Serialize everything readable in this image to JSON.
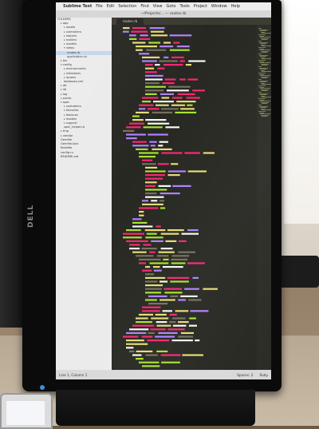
{
  "scene": {
    "monitor_brand": "DELL"
  },
  "menubar": {
    "app_name": "Sublime Text",
    "items": [
      "File",
      "Edit",
      "Selection",
      "Find",
      "View",
      "Goto",
      "Tools",
      "Project",
      "Window",
      "Help"
    ]
  },
  "window": {
    "title": "~/Projects/... — routes.rb"
  },
  "sidebar": {
    "items": [
      {
        "label": "FOLDERS",
        "indent": 0,
        "arrow": "",
        "selected": false
      },
      {
        "label": "app",
        "indent": 1,
        "arrow": "▸",
        "selected": false
      },
      {
        "label": "assets",
        "indent": 2,
        "arrow": "▸",
        "selected": false
      },
      {
        "label": "controllers",
        "indent": 2,
        "arrow": "▸",
        "selected": false
      },
      {
        "label": "helpers",
        "indent": 2,
        "arrow": "▸",
        "selected": false
      },
      {
        "label": "mailers",
        "indent": 2,
        "arrow": "▸",
        "selected": false
      },
      {
        "label": "models",
        "indent": 2,
        "arrow": "▸",
        "selected": false
      },
      {
        "label": "views",
        "indent": 2,
        "arrow": "▾",
        "selected": false
      },
      {
        "label": "routes.rb",
        "indent": 3,
        "arrow": "",
        "selected": true
      },
      {
        "label": "application.rb",
        "indent": 3,
        "arrow": "",
        "selected": false
      },
      {
        "label": "bin",
        "indent": 1,
        "arrow": "▸",
        "selected": false
      },
      {
        "label": "config",
        "indent": 1,
        "arrow": "▾",
        "selected": false
      },
      {
        "label": "environments",
        "indent": 2,
        "arrow": "▸",
        "selected": false
      },
      {
        "label": "initializers",
        "indent": 2,
        "arrow": "▸",
        "selected": false
      },
      {
        "label": "locales",
        "indent": 2,
        "arrow": "▸",
        "selected": false
      },
      {
        "label": "database.yml",
        "indent": 2,
        "arrow": "",
        "selected": false
      },
      {
        "label": "db",
        "indent": 1,
        "arrow": "▸",
        "selected": false
      },
      {
        "label": "lib",
        "indent": 1,
        "arrow": "▸",
        "selected": false
      },
      {
        "label": "log",
        "indent": 1,
        "arrow": "▸",
        "selected": false
      },
      {
        "label": "public",
        "indent": 1,
        "arrow": "▸",
        "selected": false
      },
      {
        "label": "spec",
        "indent": 1,
        "arrow": "▾",
        "selected": false
      },
      {
        "label": "controllers",
        "indent": 2,
        "arrow": "▸",
        "selected": false
      },
      {
        "label": "factories",
        "indent": 2,
        "arrow": "▸",
        "selected": false
      },
      {
        "label": "features",
        "indent": 2,
        "arrow": "▸",
        "selected": false
      },
      {
        "label": "models",
        "indent": 2,
        "arrow": "▸",
        "selected": false
      },
      {
        "label": "support",
        "indent": 2,
        "arrow": "▸",
        "selected": false
      },
      {
        "label": "spec_helper.rb",
        "indent": 2,
        "arrow": "",
        "selected": false
      },
      {
        "label": "tmp",
        "indent": 1,
        "arrow": "▸",
        "selected": false
      },
      {
        "label": "vendor",
        "indent": 1,
        "arrow": "▸",
        "selected": false
      },
      {
        "label": "Gemfile",
        "indent": 1,
        "arrow": "",
        "selected": false
      },
      {
        "label": "Gemfile.lock",
        "indent": 1,
        "arrow": "",
        "selected": false
      },
      {
        "label": "Rakefile",
        "indent": 1,
        "arrow": "",
        "selected": false
      },
      {
        "label": "config.ru",
        "indent": 1,
        "arrow": "",
        "selected": false
      },
      {
        "label": "README.md",
        "indent": 1,
        "arrow": "",
        "selected": false
      }
    ]
  },
  "editor": {
    "tab_label": "routes.rb"
  },
  "statusbar": {
    "left": "Line 1, Column 1",
    "tab_size": "Spaces: 2",
    "syntax": "Ruby"
  },
  "colors": {
    "editor_bg": "#272822",
    "keyword": "#f92672",
    "string": "#e6db74",
    "symbol": "#ae81ff",
    "plain": "#f8f8f2",
    "comment": "#75715e",
    "method": "#a6e22e"
  }
}
